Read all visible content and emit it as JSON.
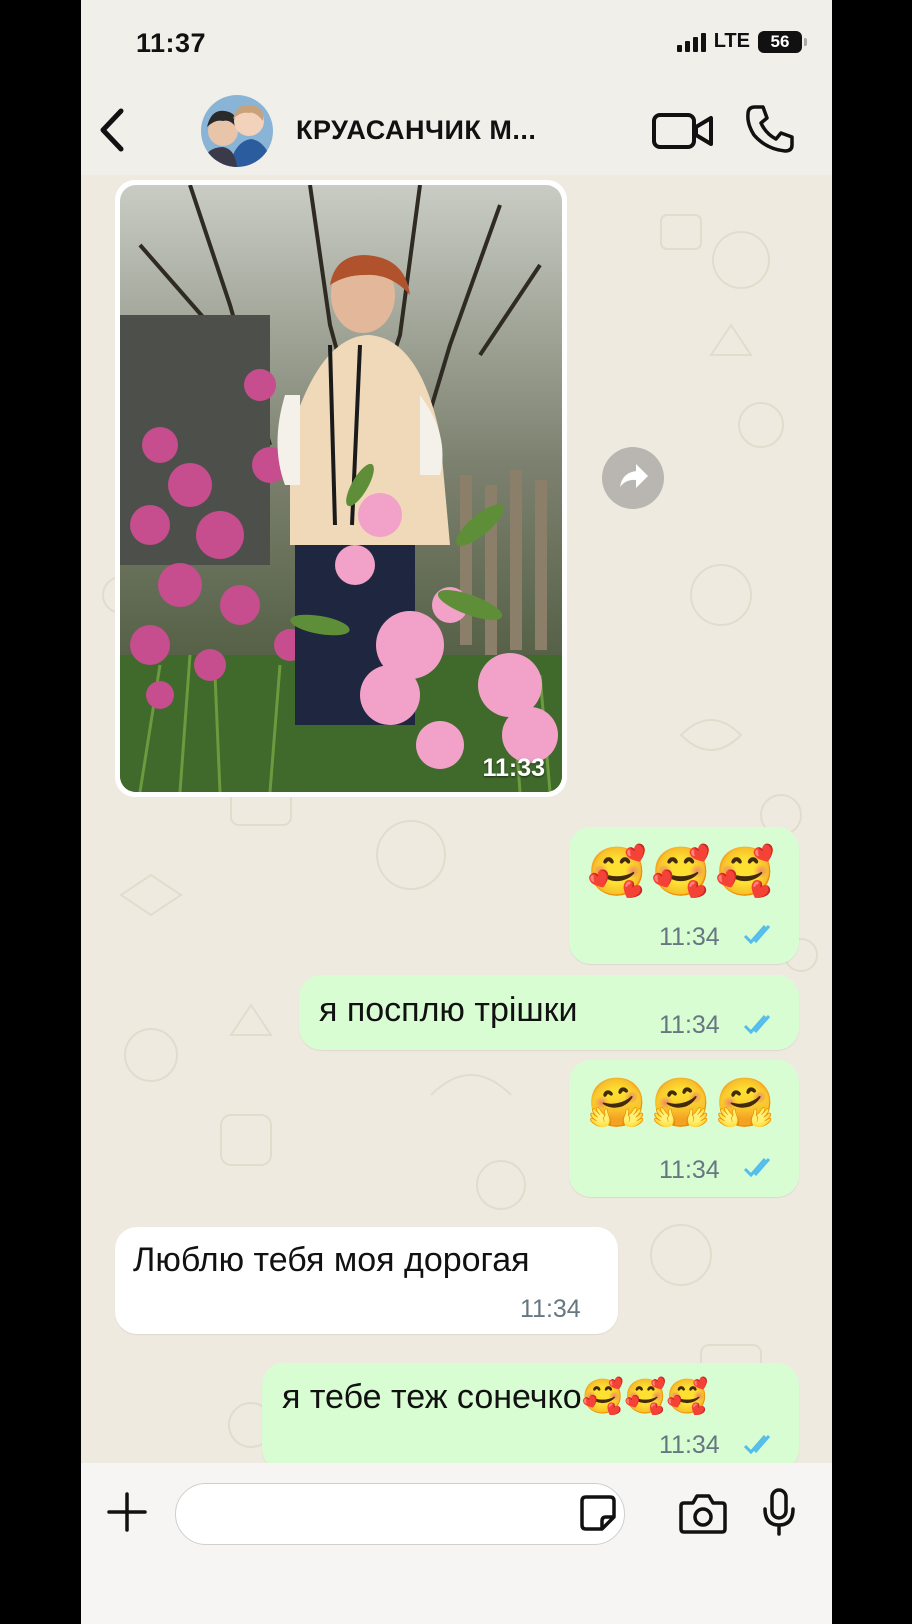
{
  "status_bar": {
    "time": "11:37",
    "network": "LTE",
    "battery": "56"
  },
  "header": {
    "contact_name": "КРУАСАНЧИК М..."
  },
  "messages": [
    {
      "type": "image",
      "direction": "in",
      "time": "11:33"
    },
    {
      "type": "emoji",
      "direction": "out",
      "emoji": [
        "🥰",
        "🥰",
        "🥰"
      ],
      "time": "11:34",
      "status": "read"
    },
    {
      "type": "text",
      "direction": "out",
      "text": "я посплю трішки",
      "time": "11:34",
      "status": "read"
    },
    {
      "type": "emoji",
      "direction": "out",
      "emoji": [
        "🤗",
        "🤗",
        "🤗"
      ],
      "time": "11:34",
      "status": "read"
    },
    {
      "type": "text",
      "direction": "in",
      "text": "Люблю тебя моя дорогая",
      "time": "11:34"
    },
    {
      "type": "text",
      "direction": "out",
      "text": "я тебе теж сонечко🥰🥰🥰",
      "time": "11:34",
      "status": "read"
    }
  ],
  "input": {
    "placeholder": ""
  },
  "icons": {
    "back": "chevron-left-icon",
    "video": "video-call-icon",
    "call": "phone-icon",
    "forward": "forward-icon",
    "plus": "plus-icon",
    "sticker": "sticker-icon",
    "camera": "camera-icon",
    "mic": "microphone-icon",
    "ticks": "double-check-icon"
  },
  "colors": {
    "outgoing_bubble": "#d9fdd3",
    "incoming_bubble": "#ffffff",
    "read_ticks": "#53bdeb",
    "chat_bg": "#efeae0"
  }
}
